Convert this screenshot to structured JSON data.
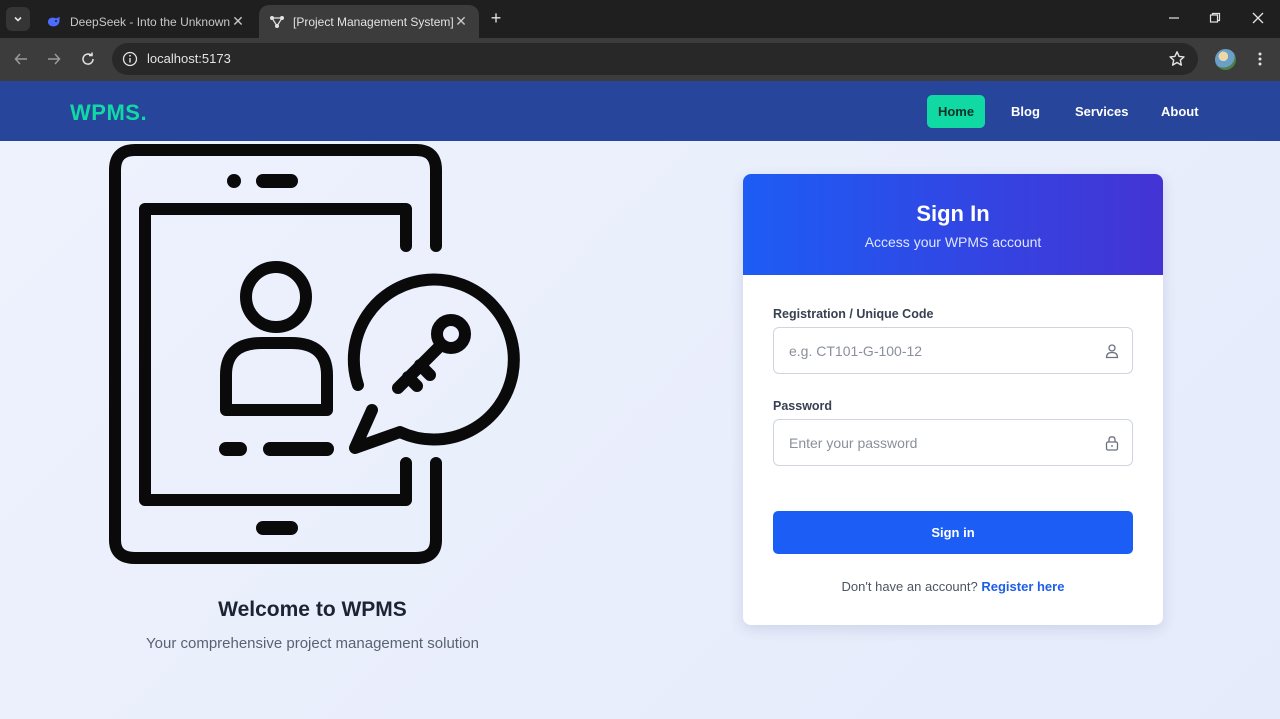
{
  "browser": {
    "tabs": [
      {
        "title": "DeepSeek - Into the Unknown",
        "active": false,
        "favicon": "deepseek-whale-icon"
      },
      {
        "title": "[Project Management System]",
        "active": true,
        "favicon": "network-nodes-icon"
      }
    ],
    "url": "localhost:5173"
  },
  "navbar": {
    "logo": "WPMS.",
    "links": [
      {
        "label": "Home",
        "active": true
      },
      {
        "label": "Blog",
        "active": false
      },
      {
        "label": "Services",
        "active": false
      },
      {
        "label": "About",
        "active": false
      }
    ]
  },
  "hero": {
    "title": "Welcome to WPMS",
    "subtitle": "Your comprehensive project management solution"
  },
  "login": {
    "title": "Sign In",
    "subtitle": "Access your WPMS account",
    "code_label": "Registration / Unique Code",
    "code_placeholder": "e.g. CT101-G-100-12",
    "password_label": "Password",
    "password_placeholder": "Enter your password",
    "submit_label": "Sign in",
    "register_prompt": "Don't have an account?",
    "register_link": "Register here"
  },
  "colors": {
    "navbar_bg": "#27459b",
    "accent_green": "#10d9a4",
    "primary_blue": "#1c5ef5",
    "header_gradient_end": "#4433d4"
  }
}
